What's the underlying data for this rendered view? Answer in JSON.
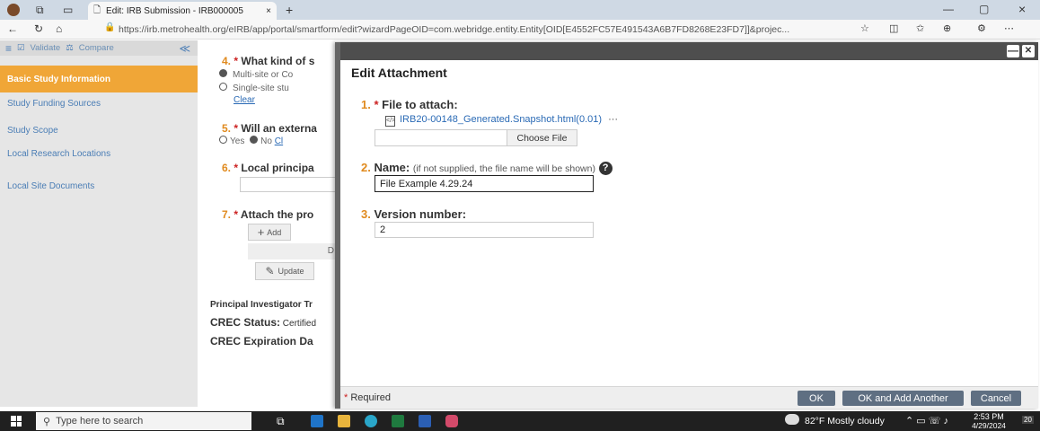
{
  "browser": {
    "tab_title": "Edit: IRB Submission - IRB000005",
    "tab_close": "×",
    "new_tab": "+",
    "url": "https://irb.metrohealth.org/eIRB/app/portal/smartform/edit?wizardPageOID=com.webridge.entity.Entity[OID[E4552FC57E491543A6B7FD8268E23FD7]]&projec...",
    "window_controls": {
      "minimize": "—",
      "restore": "▢",
      "close": "×"
    }
  },
  "nav": {
    "validate_label": "Validate",
    "compare_label": "Compare",
    "collapse": "≪",
    "items": [
      {
        "label": "Basic Study Information",
        "active": true
      },
      {
        "label": "Study Funding Sources"
      },
      {
        "label": "Study Scope"
      },
      {
        "label": "Local Research Locations"
      },
      {
        "label": "Local Site Documents"
      }
    ]
  },
  "form": {
    "q4": {
      "num": "4.",
      "label": "What kind of s",
      "opt1": "Multi-site or Co",
      "opt2": "Single-site stu",
      "clear": "Clear"
    },
    "q5": {
      "num": "5.",
      "label": "Will an externa",
      "yes": "Yes",
      "no": "No",
      "clear": "Cl"
    },
    "q6": {
      "num": "6.",
      "label": "Local principa"
    },
    "q7": {
      "num": "7.",
      "label": "Attach the pro",
      "add": "Add",
      "col": "D",
      "update": "Update"
    },
    "pi_training": "Principal Investigator Tr",
    "crec_status_label": "CREC Status:",
    "crec_status_value": "Certified",
    "crec_exp": "CREC Expiration Da"
  },
  "dialog": {
    "title": "Edit Attachment",
    "minimize": "—",
    "close": "✕",
    "q1": {
      "num": "1.",
      "label": "File to attach:",
      "file_name": "IRB20-00148_Generated.Snapshot.html(0.01)",
      "more": "···",
      "choose_file": "Choose File"
    },
    "q2": {
      "num": "2.",
      "label": "Name:",
      "hint": "(if not supplied, the file name will be shown)",
      "help": "?",
      "value": "File Example 4.29.24"
    },
    "q3": {
      "num": "3.",
      "label": "Version number:",
      "value": "2"
    },
    "required_label": "Required",
    "ok": "OK",
    "ok_add": "OK and Add Another",
    "cancel": "Cancel"
  },
  "taskbar": {
    "search_placeholder": "Type here to search",
    "weather": "82°F  Mostly cloudy",
    "time": "2:53 PM",
    "date": "4/29/2024",
    "notification_badge": "20"
  },
  "colors": {
    "accent": "#f0a637",
    "link": "#2a6ab5",
    "number": "#e08a1e",
    "button": "#5f6f82"
  }
}
